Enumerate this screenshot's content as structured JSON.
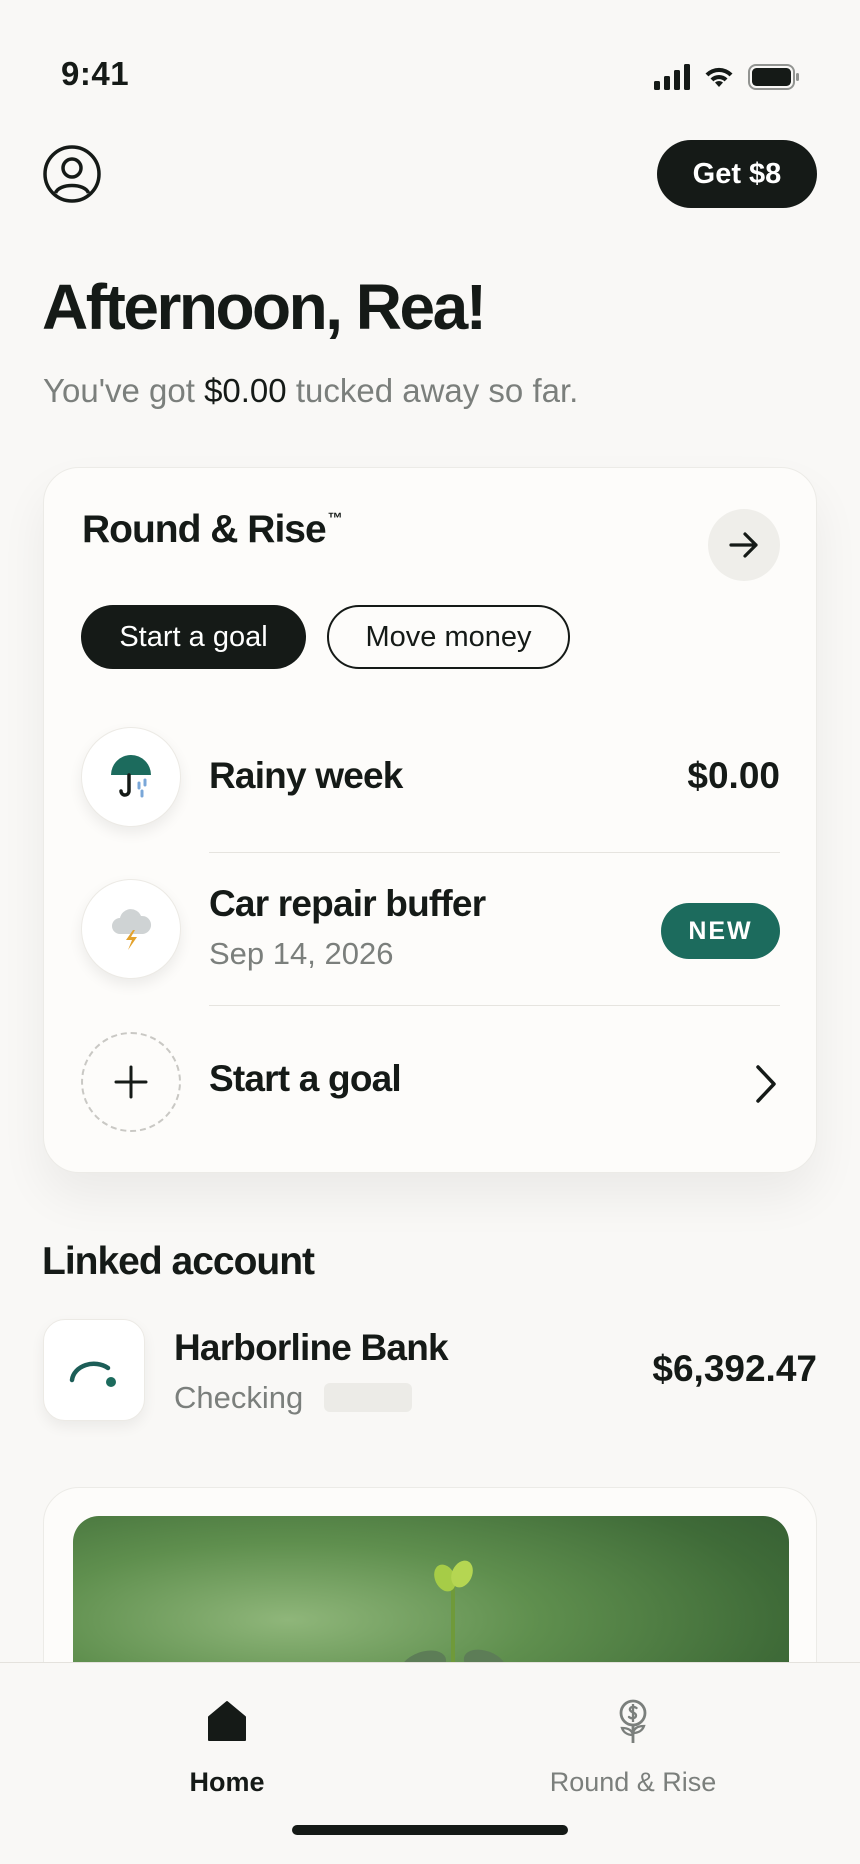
{
  "status_bar": {
    "time": "9:41"
  },
  "header": {
    "get_button_label": "Get $8"
  },
  "greeting": {
    "title": "Afternoon, Rea!",
    "prefix": "You've got",
    "amount": "$0.00",
    "suffix": "tucked away so far."
  },
  "round_rise_card": {
    "title": "Round & Rise",
    "trademark": "™",
    "start_goal_label": "Start a goal",
    "move_money_label": "Move money",
    "goals": [
      {
        "name": "Rainy week",
        "amount": "$0.00",
        "icon": "umbrella-icon"
      },
      {
        "name": "Car repair buffer",
        "date": "Sep 14, 2026",
        "badge": "NEW",
        "icon": "storm-cloud-icon"
      }
    ],
    "add_goal_label": "Start a goal"
  },
  "linked_account": {
    "section_title": "Linked account",
    "bank_name": "Harborline Bank",
    "account_type": "Checking",
    "balance": "$6,392.47"
  },
  "tab_bar": {
    "tabs": [
      {
        "label": "Home",
        "icon": "home-icon",
        "active": true
      },
      {
        "label": "Round & Rise",
        "icon": "money-plant-icon",
        "active": false
      }
    ]
  },
  "colors": {
    "background": "#f9f8f6",
    "primary_dark": "#151a17",
    "accent_teal": "#1c6b5d",
    "muted_text": "#7b7f7c"
  }
}
